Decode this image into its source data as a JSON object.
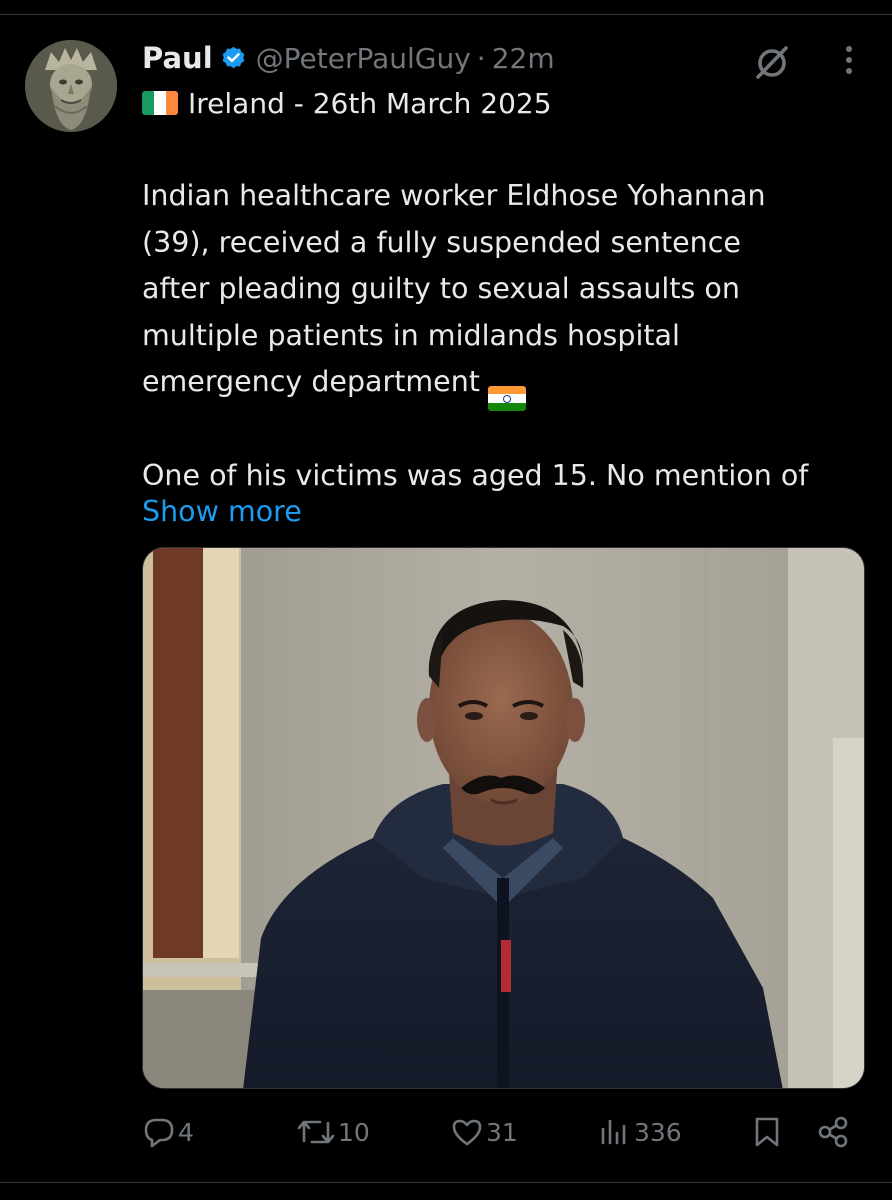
{
  "tweet": {
    "author_name": "Paul",
    "handle": "@PeterPaulGuy",
    "separator": "·",
    "time": "22m",
    "verified_badge_icon": "verified-badge-icon",
    "location_line": "Ireland - 26th March 2025",
    "location_flag_colors": [
      "#169b62",
      "#ffffff",
      "#ff883e"
    ],
    "body_lines": [
      "Indian healthcare worker Eldhose Yohannan",
      "(39), received a fully suspended sentence",
      "after pleading guilty to sexual assaults on",
      "multiple patients in midlands hospital",
      "emergency department"
    ],
    "body_line_after_gap": "One of his victims was aged 15. No mention of",
    "body_flag_colors": [
      "#ff9933",
      "#ffffff",
      "#138808"
    ],
    "show_more": "Show more",
    "media_icon": "photo-of-man-in-navy-hooded-jacket"
  },
  "metrics": {
    "replies": "4",
    "reposts": "10",
    "likes": "31",
    "views": "336"
  },
  "icons": {
    "grok": "grok-icon",
    "more": "more-options-icon",
    "reply": "reply-icon",
    "repost": "repost-icon",
    "like": "like-icon",
    "views": "views-icon",
    "bookmark": "bookmark-icon",
    "share": "share-icon"
  },
  "colors": {
    "background": "#000000",
    "text": "#e7e9ea",
    "secondary": "#71767b",
    "link": "#1d9bf0",
    "divider": "#2f3336"
  }
}
